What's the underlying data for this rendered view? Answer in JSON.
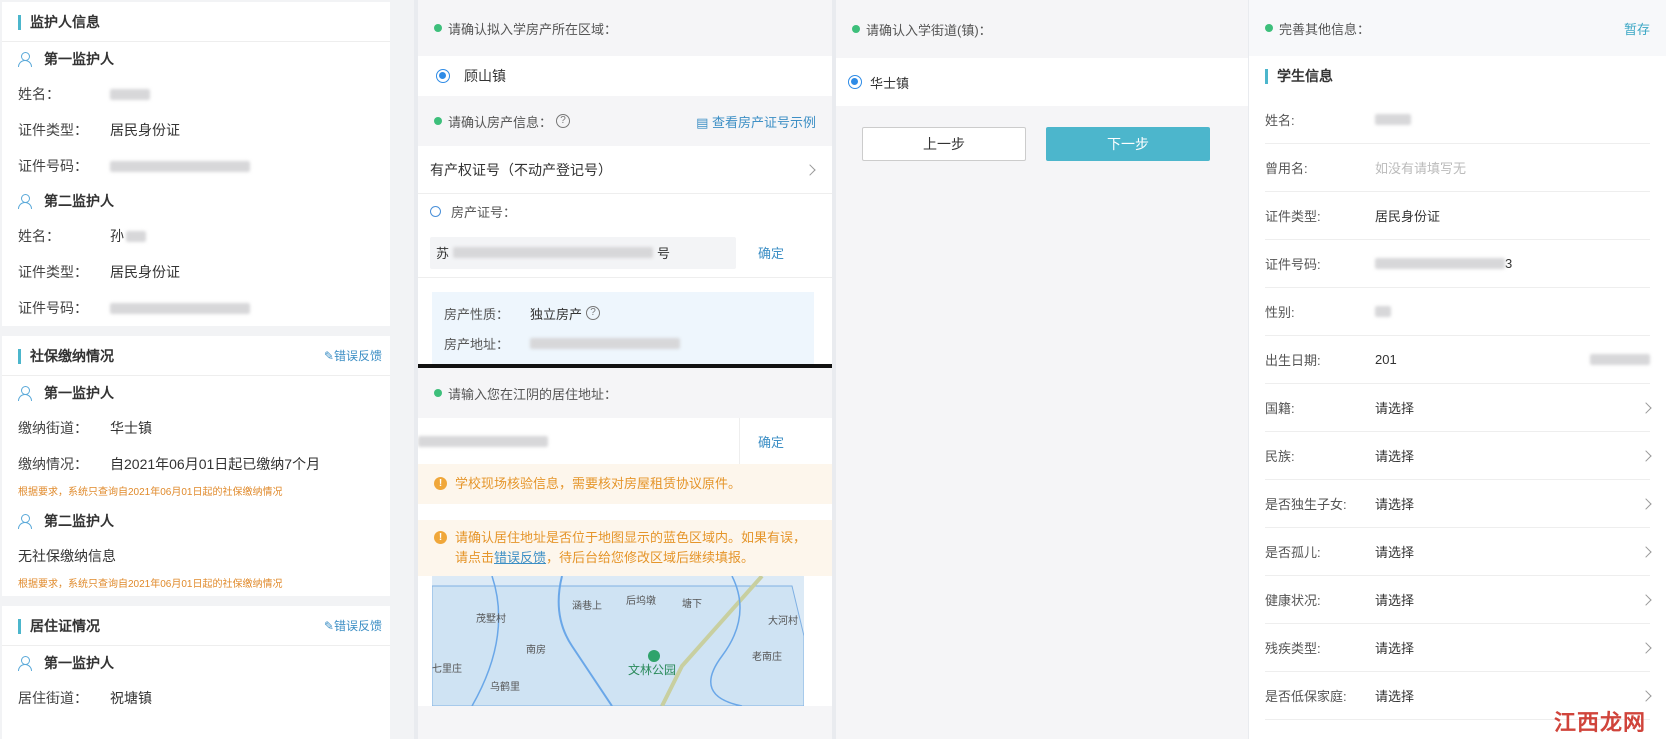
{
  "guardian": {
    "title": "监护人信息",
    "first_header": "第一监护人",
    "second_header": "第二监护人",
    "name_label": "姓名：",
    "id_type_label": "证件类型：",
    "id_type_value": "居民身份证",
    "id_no_label": "证件号码：",
    "second_name_value": "孙"
  },
  "social": {
    "title": "社保缴纳情况",
    "feedback": "错误反馈",
    "first_header": "第一监护人",
    "street_label": "缴纳街道：",
    "street_value": "华士镇",
    "status_label": "缴纳情况：",
    "status_value": "自2021年06月01日起已缴纳7个月",
    "note1": "根据要求，系统只查询自2021年06月01日起的社保缴纳情况",
    "second_header": "第二监护人",
    "none_text": "无社保缴纳信息",
    "note2": "根据要求，系统只查询自2021年06月01日起的社保缴纳情况"
  },
  "residence": {
    "title": "居住证情况",
    "feedback": "错误反馈",
    "first_header": "第一监护人",
    "street_label": "居住街道：",
    "street_value": "祝塘镇"
  },
  "property": {
    "region_prompt": "请确认拟入学房产所在区域：",
    "region_value": "顾山镇",
    "info_prompt": "请确认房产信息：",
    "help_mark": "?",
    "sample_link": "查看房产证号示例",
    "cert_type": "有产权证号（不动产登记号）",
    "cert_no_label": "房产证号：",
    "cert_prefix": "苏",
    "cert_suffix": "号",
    "confirm": "确定",
    "nature_label": "房产性质：",
    "nature_value": "独立房产",
    "address_label": "房产地址："
  },
  "residence_addr": {
    "prompt": "请输入您在江阴的居住地址：",
    "confirm": "确定",
    "warn1": "学校现场核验信息，需要核对房屋租赁协议原件。",
    "warn2_a": "请确认居住地址是否位于地图显示的蓝色区域内。如果有误，请点击",
    "warn2_link": "错误反馈",
    "warn2_b": "，待后台给您修改区域后继续填报。",
    "warn_icon": "!"
  },
  "map": {
    "labels": [
      "茂墅村",
      "涵巷上",
      "后坞墩",
      "塘下",
      "大河村",
      "南房",
      "老南庄",
      "七里庄",
      "乌鹤里",
      "文林公园"
    ]
  },
  "street": {
    "prompt": "请确认入学街道(镇)：",
    "value": "华士镇",
    "prev": "上一步",
    "next": "下一步"
  },
  "student": {
    "prompt": "完善其他信息：",
    "save": "暂存",
    "title": "学生信息",
    "fields": [
      {
        "label": "姓名:",
        "value": ""
      },
      {
        "label": "曾用名:",
        "placeholder": "如没有请填写无"
      },
      {
        "label": "证件类型:",
        "value": "居民身份证"
      },
      {
        "label": "证件号码:",
        "value": "3"
      },
      {
        "label": "性别:",
        "value": ""
      },
      {
        "label": "出生日期:",
        "value": "201"
      },
      {
        "label": "国籍:",
        "value": "请选择"
      },
      {
        "label": "民族:",
        "value": "请选择"
      },
      {
        "label": "是否独生子女:",
        "value": "请选择"
      },
      {
        "label": "是否孤儿:",
        "value": "请选择"
      },
      {
        "label": "健康状况:",
        "value": "请选择"
      },
      {
        "label": "残疾类型:",
        "value": "请选择"
      },
      {
        "label": "是否低保家庭:",
        "value": "请选择"
      }
    ]
  },
  "watermark": "江西龙网",
  "colors": {
    "accent": "#4cb6cc",
    "link": "#3d8fc5",
    "green_dot": "#3dbf7b",
    "warn": "#e5952a"
  }
}
